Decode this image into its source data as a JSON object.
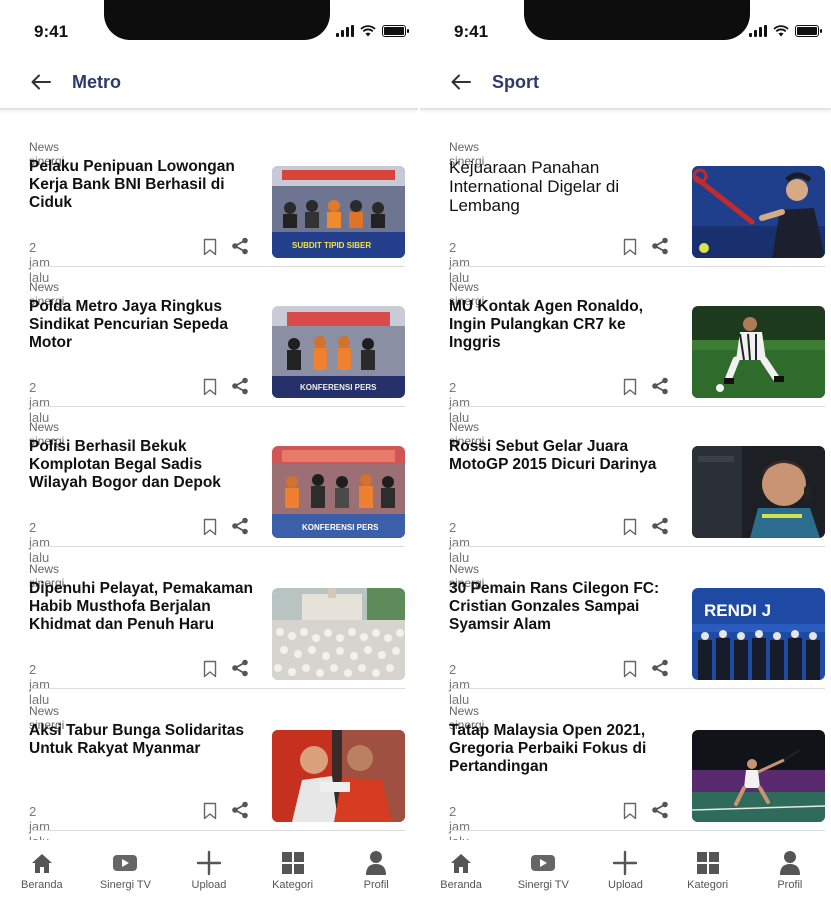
{
  "status_bar": {
    "time": "9:41"
  },
  "screens": [
    {
      "header_title": "Metro",
      "articles": [
        {
          "source": "News sinergi",
          "title": "Pelaku Penipuan Lowongan Kerja Bank BNI Berhasil di Ciduk",
          "time": "2 jam lalu",
          "image": "press-conference-photo",
          "image_text": "SUBDIT TIPID SIBER"
        },
        {
          "source": "News sinergi",
          "title": "Polda Metro Jaya Ringkus Sindikat Pencurian Sepeda Motor",
          "time": "2 jam lalu",
          "image": "press-conference-photo",
          "image_text": "KONFERENSI PERS"
        },
        {
          "source": "News sinergi",
          "title": "Polisi Berhasil Bekuk Komplotan Begal Sadis Wilayah Bogor dan Depok",
          "time": "2 jam lalu",
          "image": "press-conference-photo",
          "image_text": "KONFERENSI PERS"
        },
        {
          "source": "News sinergi",
          "title": "Dipenuhi Pelayat, Pemakaman Habib Musthofa Berjalan Khidmat dan Penuh Haru",
          "time": "2 jam lalu",
          "image": "mosque-crowd-photo",
          "image_text": ""
        },
        {
          "source": "News sinergi",
          "title": "Aksi Tabur Bunga Solidaritas Untuk Rakyat Myanmar",
          "time": "2 jam lalu",
          "image": "racers-embrace-photo",
          "image_text": ""
        }
      ]
    },
    {
      "header_title": "Sport",
      "articles": [
        {
          "source": "News sinergi",
          "title": "Kejuaraan Panahan International Digelar di Lembang",
          "time": "2 jam lalu",
          "image": "tennis-player-photo",
          "image_text": "",
          "light": true
        },
        {
          "source": "News sinergi",
          "title": "MU Kontak Agen Ronaldo, Ingin Pulangkan CR7 ke Inggris",
          "time": "2 jam lalu",
          "image": "football-player-photo",
          "image_text": ""
        },
        {
          "source": "News sinergi",
          "title": "Rossi Sebut Gelar Juara MotoGP 2015 Dicuri Darinya",
          "time": "2 jam lalu",
          "image": "rider-interview-photo",
          "image_text": ""
        },
        {
          "source": "News sinergi",
          "title": "30 Pemain Rans Cilegon FC: Cristian Gonzales Sampai Syamsir Alam",
          "time": "2 jam lalu",
          "image": "team-lineup-photo",
          "image_text": "RENDI J"
        },
        {
          "source": "News sinergi",
          "title": "Tatap Malaysia Open 2021, Gregoria Perbaiki Fokus di Pertandingan",
          "time": "2 jam lalu",
          "image": "badminton-court-photo",
          "image_text": ""
        }
      ]
    }
  ],
  "bottom_nav": [
    {
      "label": "Beranda",
      "icon": "home-icon"
    },
    {
      "label": "Sinergi TV",
      "icon": "play-icon"
    },
    {
      "label": "Upload",
      "icon": "plus-icon"
    },
    {
      "label": "Kategori",
      "icon": "grid-icon"
    },
    {
      "label": "Profil",
      "icon": "user-icon"
    }
  ],
  "colors": {
    "header_title": "#2d3a6b",
    "text": "#111111",
    "muted": "#777777",
    "nav_icon": "#555555"
  }
}
